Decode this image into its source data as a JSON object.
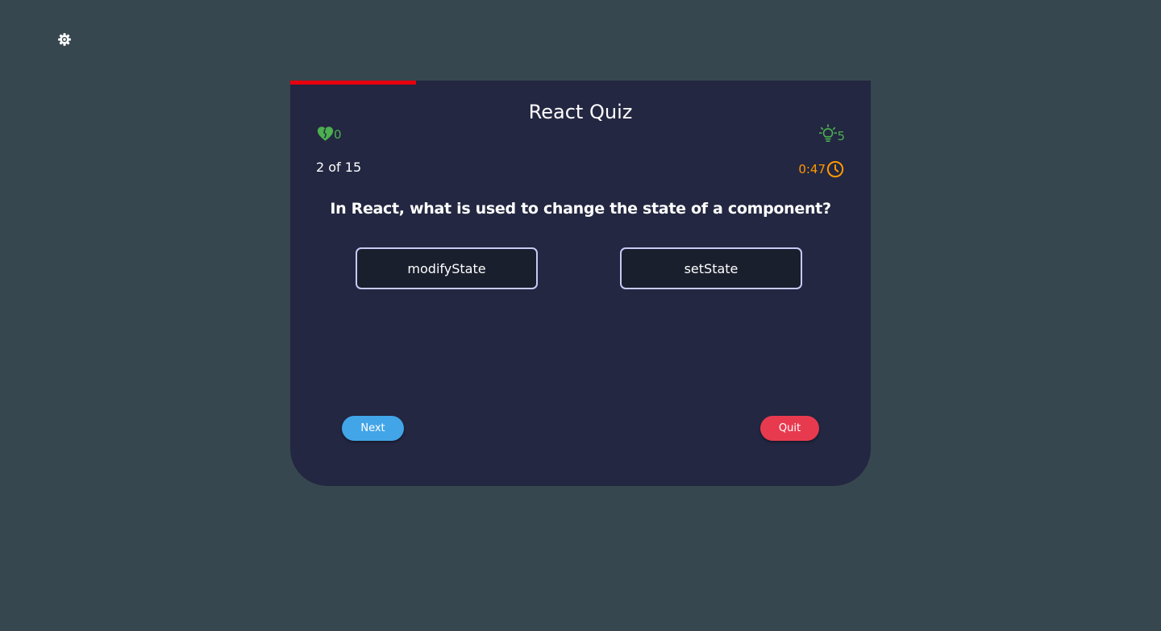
{
  "quiz": {
    "title": "React Quiz",
    "progress_fraction": 0.216,
    "lives": "0",
    "hints": "5",
    "counter": "2 of 15",
    "timer": "0:47",
    "question": "In React, what is used to change the state of a component?",
    "options": [
      {
        "label": "modifyState"
      },
      {
        "label": "setState"
      }
    ],
    "next_label": "Next",
    "quit_label": "Quit"
  },
  "icons": {
    "settings": "gear-icon",
    "lives": "heart-icon",
    "hints": "lightbulb-icon",
    "timer": "clock-icon"
  },
  "colors": {
    "background": "#37474f",
    "card": "#232741",
    "progress": "#e6000f",
    "lives": "#4caf50",
    "timer": "#ff9800",
    "next_button": "#42a5e8",
    "quit_button": "#e83a4f"
  }
}
